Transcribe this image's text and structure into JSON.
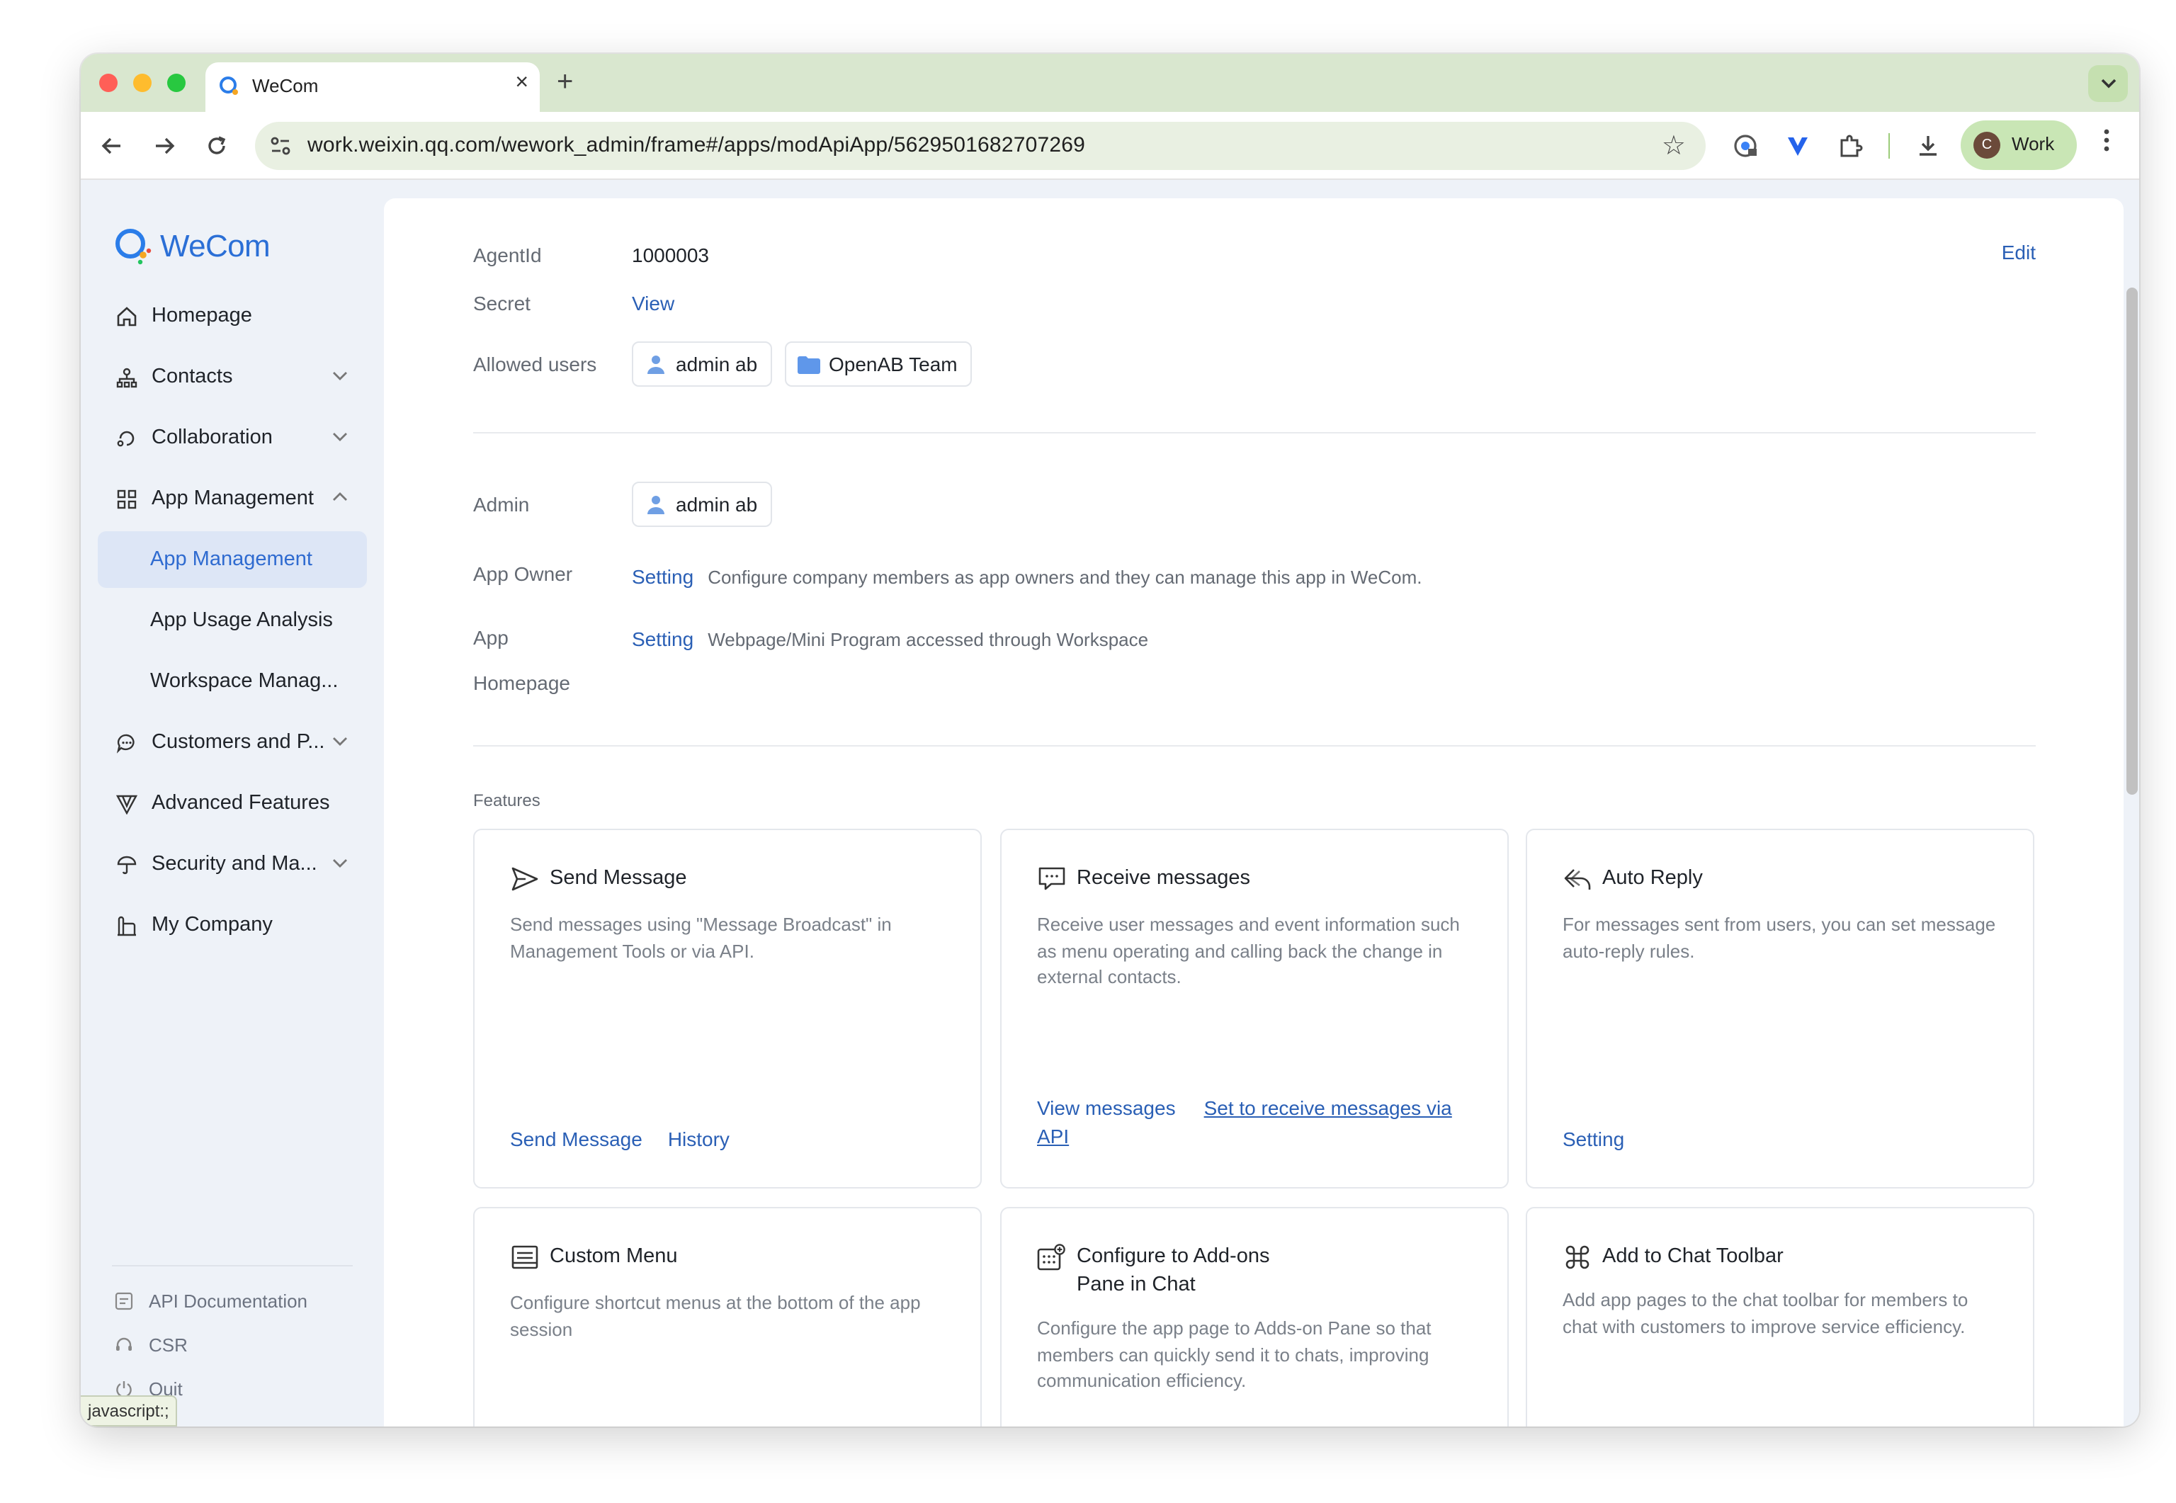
{
  "browser": {
    "tab_title": "WeCom",
    "url_host": "work.weixin.qq.com",
    "url_path": "/wework_admin/frame#/apps/modApiApp/5629501682707269",
    "profile_initial": "C",
    "profile_label": "Work",
    "status_text": "javascript:;"
  },
  "sidebar": {
    "logo_text": "WeCom",
    "items": [
      {
        "label": "Homepage"
      },
      {
        "label": "Contacts"
      },
      {
        "label": "Collaboration"
      },
      {
        "label": "App Management"
      },
      {
        "label": "App Management"
      },
      {
        "label": "App Usage Analysis"
      },
      {
        "label": "Workspace Manag..."
      },
      {
        "label": "Customers and P..."
      },
      {
        "label": "Advanced Features"
      },
      {
        "label": "Security and Ma..."
      },
      {
        "label": "My Company"
      }
    ],
    "footer": [
      {
        "label": "API Documentation"
      },
      {
        "label": "CSR"
      },
      {
        "label": "Quit"
      }
    ]
  },
  "details": {
    "edit_label": "Edit",
    "agentid_label": "AgentId",
    "agentid_value": "1000003",
    "secret_label": "Secret",
    "secret_link": "View",
    "allowed_users_label": "Allowed users",
    "allowed_users": [
      "admin ab",
      "OpenAB Team"
    ],
    "admin_label": "Admin",
    "admin_value": "admin ab",
    "app_owner_label": "App Owner",
    "app_owner_link": "Setting",
    "app_owner_desc": "Configure company members as app owners and they can manage this app in WeCom.",
    "app_homepage_label_1": "App",
    "app_homepage_label_2": "Homepage",
    "app_homepage_link": "Setting",
    "app_homepage_desc": "Webpage/Mini Program accessed through Workspace"
  },
  "features": {
    "title": "Features",
    "cards": [
      {
        "title": "Send Message",
        "desc": "Send messages using \"Message Broadcast\" in Management Tools or via API.",
        "actions": [
          "Send Message",
          "History"
        ]
      },
      {
        "title": "Receive messages",
        "desc": "Receive user messages and event information such as menu operating and calling back the change in external contacts.",
        "actions": [
          "View messages",
          "Set to receive messages via API"
        ]
      },
      {
        "title": "Auto Reply",
        "desc": "For messages sent from users, you can set message auto-reply rules.",
        "actions": [
          "Setting"
        ]
      },
      {
        "title": "Custom Menu",
        "desc": "Configure shortcut menus at the bottom of the app session"
      },
      {
        "title_1": "Configure to Add-ons",
        "title_2": "Pane in Chat",
        "desc": "Configure the app page to Adds-on Pane so that members can quickly send it to chats, improving communication efficiency."
      },
      {
        "title": "Add to Chat Toolbar",
        "desc": "Add app pages to the chat toolbar for members to chat with customers to improve service efficiency."
      }
    ]
  },
  "colors": {
    "accent": "#2a5fb5",
    "active_bg": "#dde6f6",
    "sidebar_bg": "#eef2f8"
  }
}
